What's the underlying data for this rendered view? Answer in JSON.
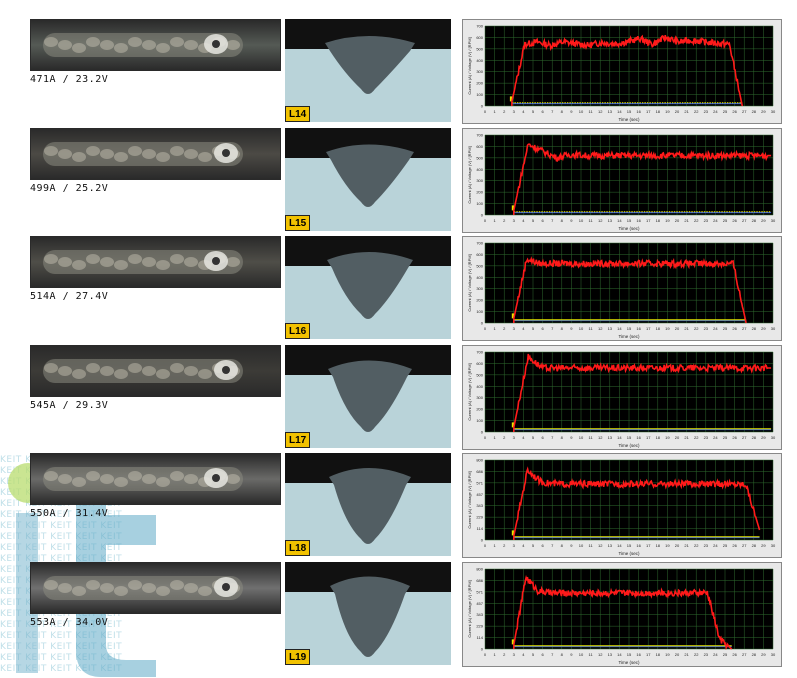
{
  "watermark": {
    "text": "KEIT KEIT KEIT KEIT KEIT",
    "logo": "it"
  },
  "rows": [
    {
      "caption": "471A / 23.2V",
      "label": "L14",
      "bead_tone": "#555a55",
      "trace": [
        40,
        540,
        560,
        530,
        560,
        545,
        530,
        555,
        545,
        560,
        590,
        540,
        600,
        560,
        575,
        560,
        550,
        540,
        0
      ],
      "start": 2.8,
      "end": 26.8,
      "ylim": [
        0,
        700
      ]
    },
    {
      "caption": "499A / 25.2V",
      "label": "L15",
      "bead_tone": "#4c4a45",
      "trace": [
        40,
        620,
        560,
        500,
        530,
        520,
        520,
        520,
        520,
        520,
        520,
        520,
        520,
        520,
        520,
        520,
        520,
        520,
        520
      ],
      "start": 3.0,
      "end": 29.8,
      "ylim": [
        0,
        700
      ]
    },
    {
      "caption": "514A / 27.4V",
      "label": "L16",
      "bead_tone": "#4f4e48",
      "trace": [
        40,
        560,
        520,
        520,
        520,
        520,
        520,
        520,
        520,
        520,
        520,
        520,
        520,
        520,
        520,
        520,
        520,
        520,
        0
      ],
      "start": 3.0,
      "end": 27.2,
      "ylim": [
        0,
        700
      ]
    },
    {
      "caption": "545A / 29.3V",
      "label": "L17",
      "bead_tone": "#3c3b37",
      "trace": [
        40,
        660,
        560,
        560,
        560,
        560,
        560,
        560,
        560,
        560,
        560,
        560,
        560,
        560,
        560,
        560,
        560,
        560,
        560
      ],
      "start": 3.0,
      "end": 29.8,
      "ylim": [
        0,
        700
      ]
    },
    {
      "caption": "550A / 31.4V",
      "label": "L18",
      "bead_tone": "#6a6a68",
      "trace": [
        40,
        700,
        580,
        560,
        560,
        560,
        560,
        560,
        560,
        560,
        560,
        560,
        560,
        560,
        560,
        560,
        560,
        560,
        100
      ],
      "start": 3.0,
      "end": 28.6,
      "ylim": [
        0,
        800
      ]
    },
    {
      "caption": "553A / 34.0V",
      "label": "L19",
      "bead_tone": "#707070",
      "trace": [
        40,
        720,
        580,
        560,
        560,
        560,
        560,
        560,
        560,
        560,
        560,
        560,
        560,
        560,
        560,
        560,
        560,
        100,
        0
      ],
      "start": 3.0,
      "end": 25.7,
      "ylim": [
        0,
        800
      ]
    }
  ],
  "chart_axes": {
    "xlabel": "Time (sec)",
    "ylabel": "Current (A) / Voltage (V) / [RPM]",
    "x_ticks": [
      "0",
      "1",
      "2",
      "3",
      "4",
      "5",
      "6",
      "7",
      "8",
      "9",
      "10",
      "11",
      "12",
      "13",
      "14",
      "15",
      "16",
      "17",
      "18",
      "19",
      "20",
      "21",
      "22",
      "23",
      "24",
      "25",
      "26",
      "27",
      "28",
      "29",
      "30"
    ]
  },
  "colors": {
    "current": "#ff1a1a",
    "voltage": "#e6e600",
    "baseline": "#2b5cff",
    "grid": "#2f6b2f",
    "plot_bg": "#000000",
    "label_bg": "#f2c200",
    "macro_bg": "#b9d3d9",
    "macro_weld": "#525e63"
  }
}
